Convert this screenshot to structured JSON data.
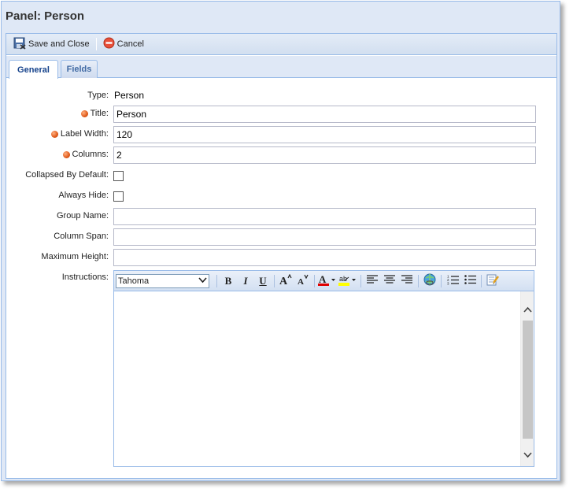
{
  "window": {
    "title": "Panel: Person"
  },
  "toolbar": {
    "save_close_label": "Save and Close",
    "cancel_label": "Cancel"
  },
  "tabs": [
    {
      "label": "General",
      "active": true
    },
    {
      "label": "Fields",
      "active": false
    }
  ],
  "form": {
    "type": {
      "label": "Type:",
      "value": "Person"
    },
    "title": {
      "label": "Title:",
      "value": "Person",
      "required": true
    },
    "label_width": {
      "label": "Label Width:",
      "value": "120",
      "required": true
    },
    "columns": {
      "label": "Columns:",
      "value": "2",
      "required": true
    },
    "collapsed_by_default": {
      "label": "Collapsed By Default:",
      "checked": false
    },
    "always_hide": {
      "label": "Always Hide:",
      "checked": false
    },
    "group_name": {
      "label": "Group Name:",
      "value": ""
    },
    "column_span": {
      "label": "Column Span:",
      "value": ""
    },
    "maximum_height": {
      "label": "Maximum Height:",
      "value": ""
    },
    "instructions": {
      "label": "Instructions:",
      "font": "Tahoma",
      "content": ""
    }
  },
  "colors": {
    "required_dot": "#e05a1a",
    "accent": "#15428b",
    "border": "#99bbe8"
  }
}
